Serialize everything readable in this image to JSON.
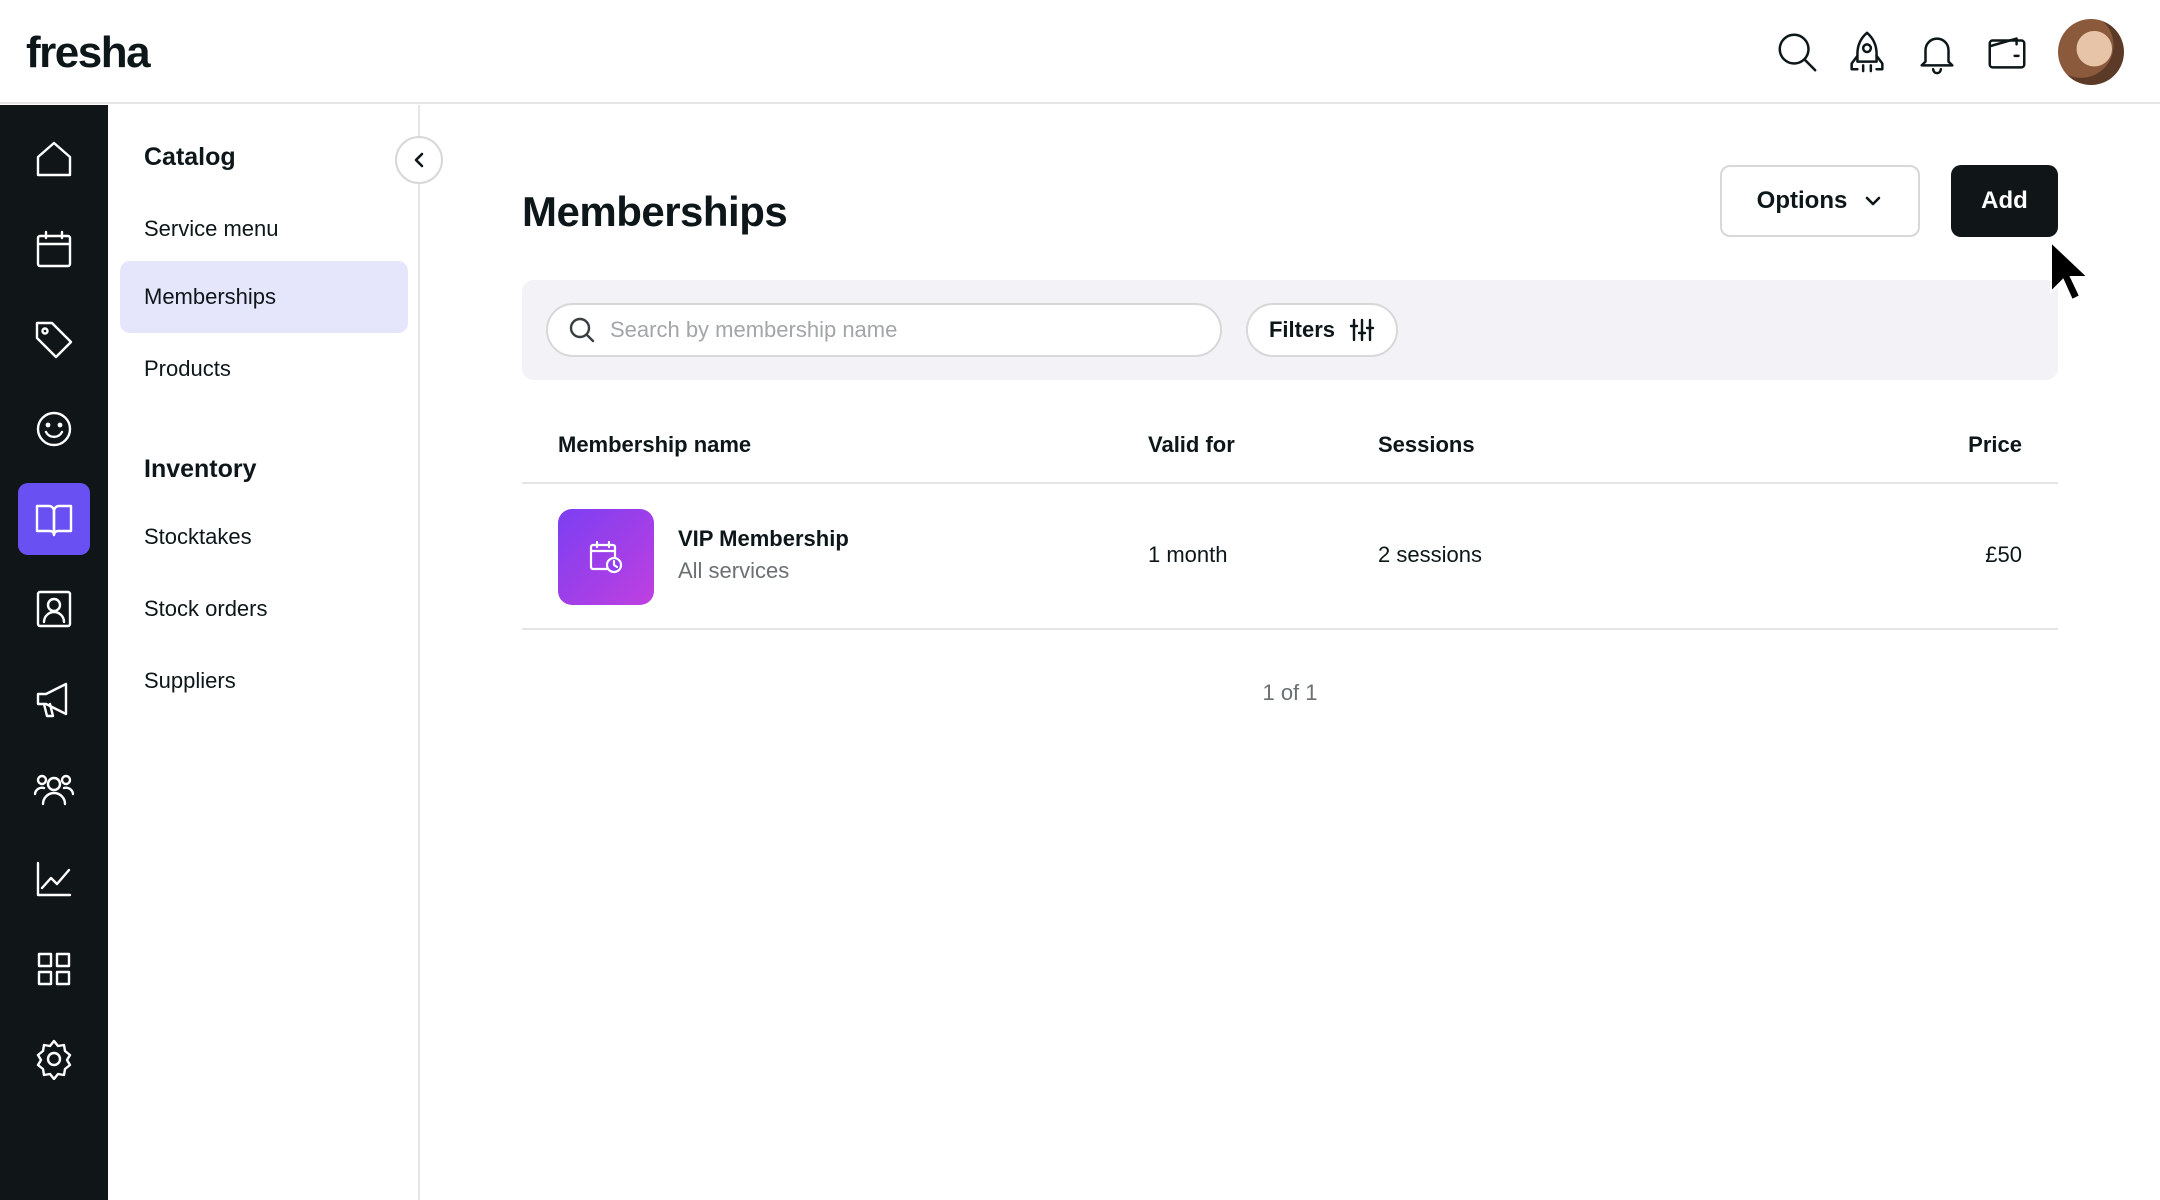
{
  "app": {
    "logo": "fresha"
  },
  "topbar": {
    "icons": [
      "search-icon",
      "rocket-icon",
      "bell-icon",
      "wallet-icon"
    ],
    "avatar": "user-avatar"
  },
  "rail": {
    "items": [
      {
        "icon": "home-icon"
      },
      {
        "icon": "calendar-icon"
      },
      {
        "icon": "tag-icon"
      },
      {
        "icon": "smiley-icon"
      },
      {
        "icon": "book-icon",
        "active": true
      },
      {
        "icon": "contact-card-icon"
      },
      {
        "icon": "megaphone-icon"
      },
      {
        "icon": "team-icon"
      },
      {
        "icon": "chart-icon"
      },
      {
        "icon": "apps-grid-icon"
      },
      {
        "icon": "settings-gear-icon"
      }
    ],
    "active_color": "#6950f3"
  },
  "subnav": {
    "catalog_title": "Catalog",
    "catalog_items": [
      "Service menu",
      "Memberships",
      "Products"
    ],
    "inventory_title": "Inventory",
    "inventory_items": [
      "Stocktakes",
      "Stock orders",
      "Suppliers"
    ],
    "active_item": "Memberships"
  },
  "main": {
    "title": "Memberships",
    "options_label": "Options",
    "add_label": "Add",
    "search_placeholder": "Search by membership name",
    "search_value": "",
    "filters_label": "Filters",
    "columns": {
      "name": "Membership name",
      "valid_for": "Valid for",
      "sessions": "Sessions",
      "price": "Price"
    },
    "rows": [
      {
        "name": "VIP Membership",
        "subtitle": "All services",
        "valid_for": "1 month",
        "sessions": "2 sessions",
        "price": "£50"
      }
    ],
    "pagination": "1 of 1"
  }
}
